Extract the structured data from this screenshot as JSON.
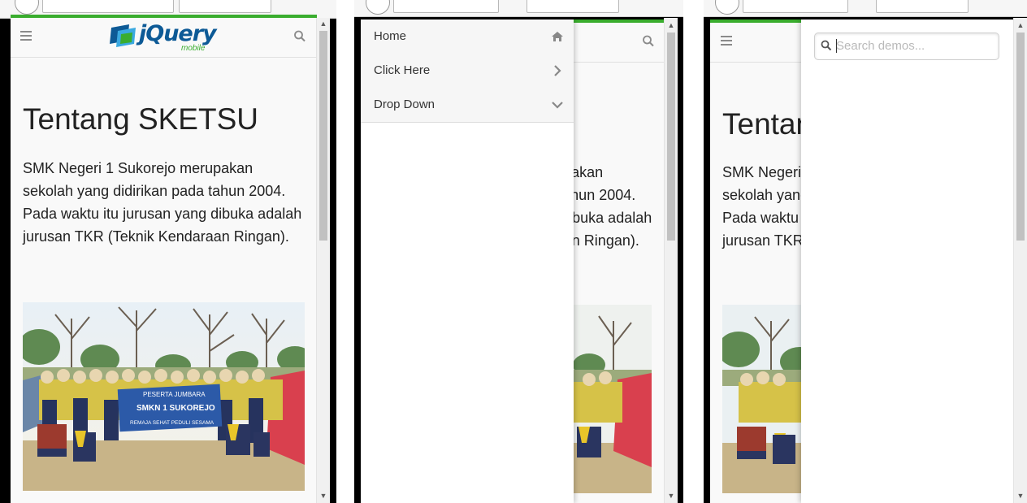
{
  "app": {
    "logo_text": "jQuery",
    "logo_sub": "mobile"
  },
  "page": {
    "title": "Tentang SKETSU",
    "paragraph": "SMK Negeri 1 Sukorejo merupakan sekolah yang didirikan pada tahun 2004. Pada waktu itu jurusan yang dibuka adalah jurusan TKR (Teknik Kendaraan Ringan).",
    "photo_banner_line1": "PESERTA JUMBARA",
    "photo_banner_line2": "SMKN 1 SUKOREJO",
    "photo_banner_line3": "REMAJA SEHAT PEDULI SESAMA"
  },
  "nav_panel": {
    "items": [
      {
        "label": "Home",
        "icon": "home-icon"
      },
      {
        "label": "Click Here",
        "icon": "chevron-right-icon"
      },
      {
        "label": "Drop Down",
        "icon": "chevron-down-icon"
      }
    ]
  },
  "search_panel": {
    "placeholder": "Search demos..."
  },
  "colors": {
    "accent_green": "#3aad2e",
    "logo_blue": "#0d5a96",
    "text": "#222222"
  }
}
